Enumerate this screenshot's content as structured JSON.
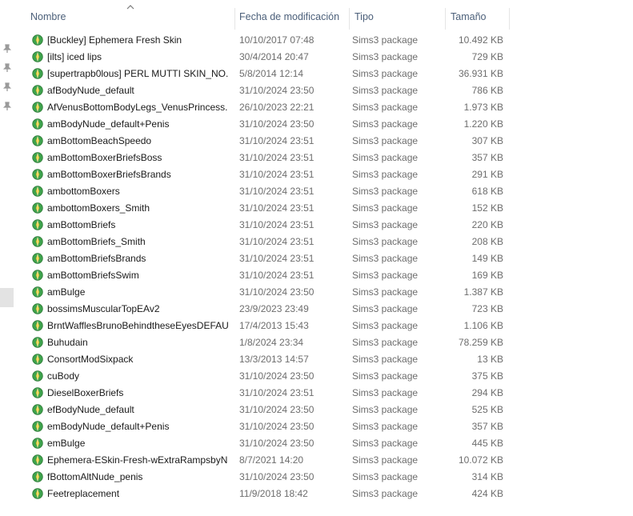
{
  "columns": {
    "name": "Nombre",
    "date": "Fecha de modificación",
    "type": "Tipo",
    "size": "Tamaño"
  },
  "sort": {
    "column": "name",
    "direction": "ascending"
  },
  "icons": {
    "file_icon": "sims3-package-icon",
    "pin_icon": "pin-icon"
  },
  "colors": {
    "icon_green": "#3fa34d",
    "icon_yellow": "#e3c52a",
    "header_text": "#4c607a"
  },
  "files": [
    {
      "name": "[Buckley] Ephemera Fresh Skin",
      "date": "10/10/2017 07:48",
      "type": "Sims3 package",
      "size": "10.492 KB"
    },
    {
      "name": "[ilts] iced lips",
      "date": "30/4/2014 20:47",
      "type": "Sims3 package",
      "size": "729 KB"
    },
    {
      "name": "[supertrapb0lous] PERL MUTTI SKIN_NO...",
      "date": "5/8/2014 12:14",
      "type": "Sims3 package",
      "size": "36.931 KB"
    },
    {
      "name": "afBodyNude_default",
      "date": "31/10/2024 23:50",
      "type": "Sims3 package",
      "size": "786 KB"
    },
    {
      "name": "AfVenusBottomBodyLegs_VenusPrincess...",
      "date": "26/10/2023 22:21",
      "type": "Sims3 package",
      "size": "1.973 KB"
    },
    {
      "name": "amBodyNude_default+Penis",
      "date": "31/10/2024 23:50",
      "type": "Sims3 package",
      "size": "1.220 KB"
    },
    {
      "name": "amBottomBeachSpeedo",
      "date": "31/10/2024 23:51",
      "type": "Sims3 package",
      "size": "307 KB"
    },
    {
      "name": "amBottomBoxerBriefsBoss",
      "date": "31/10/2024 23:51",
      "type": "Sims3 package",
      "size": "357 KB"
    },
    {
      "name": "amBottomBoxerBriefsBrands",
      "date": "31/10/2024 23:51",
      "type": "Sims3 package",
      "size": "291 KB"
    },
    {
      "name": "ambottomBoxers",
      "date": "31/10/2024 23:51",
      "type": "Sims3 package",
      "size": "618 KB"
    },
    {
      "name": "ambottomBoxers_Smith",
      "date": "31/10/2024 23:51",
      "type": "Sims3 package",
      "size": "152 KB"
    },
    {
      "name": "amBottomBriefs",
      "date": "31/10/2024 23:51",
      "type": "Sims3 package",
      "size": "220 KB"
    },
    {
      "name": "amBottomBriefs_Smith",
      "date": "31/10/2024 23:51",
      "type": "Sims3 package",
      "size": "208 KB"
    },
    {
      "name": "amBottomBriefsBrands",
      "date": "31/10/2024 23:51",
      "type": "Sims3 package",
      "size": "149 KB"
    },
    {
      "name": "amBottomBriefsSwim",
      "date": "31/10/2024 23:51",
      "type": "Sims3 package",
      "size": "169 KB"
    },
    {
      "name": "amBulge",
      "date": "31/10/2024 23:50",
      "type": "Sims3 package",
      "size": "1.387 KB"
    },
    {
      "name": "bossimsMuscularTopEAv2",
      "date": "23/9/2023 23:49",
      "type": "Sims3 package",
      "size": "723 KB"
    },
    {
      "name": "BrntWafflesBrunoBehindtheseEyesDEFAU...",
      "date": "17/4/2013 15:43",
      "type": "Sims3 package",
      "size": "1.106 KB"
    },
    {
      "name": "Buhudain",
      "date": "1/8/2024 23:34",
      "type": "Sims3 package",
      "size": "78.259 KB"
    },
    {
      "name": "ConsortModSixpack",
      "date": "13/3/2013 14:57",
      "type": "Sims3 package",
      "size": "13 KB"
    },
    {
      "name": "cuBody",
      "date": "31/10/2024 23:50",
      "type": "Sims3 package",
      "size": "375 KB"
    },
    {
      "name": "DieselBoxerBriefs",
      "date": "31/10/2024 23:51",
      "type": "Sims3 package",
      "size": "294 KB"
    },
    {
      "name": "efBodyNude_default",
      "date": "31/10/2024 23:50",
      "type": "Sims3 package",
      "size": "525 KB"
    },
    {
      "name": "emBodyNude_default+Penis",
      "date": "31/10/2024 23:50",
      "type": "Sims3 package",
      "size": "357 KB"
    },
    {
      "name": "emBulge",
      "date": "31/10/2024 23:50",
      "type": "Sims3 package",
      "size": "445 KB"
    },
    {
      "name": "Ephemera-ESkin-Fresh-wExtraRampsbyN...",
      "date": "8/7/2021 14:20",
      "type": "Sims3 package",
      "size": "10.072 KB"
    },
    {
      "name": "fBottomAltNude_penis",
      "date": "31/10/2024 23:50",
      "type": "Sims3 package",
      "size": "314 KB"
    },
    {
      "name": "Feetreplacement",
      "date": "11/9/2018 18:42",
      "type": "Sims3 package",
      "size": "424 KB"
    }
  ]
}
